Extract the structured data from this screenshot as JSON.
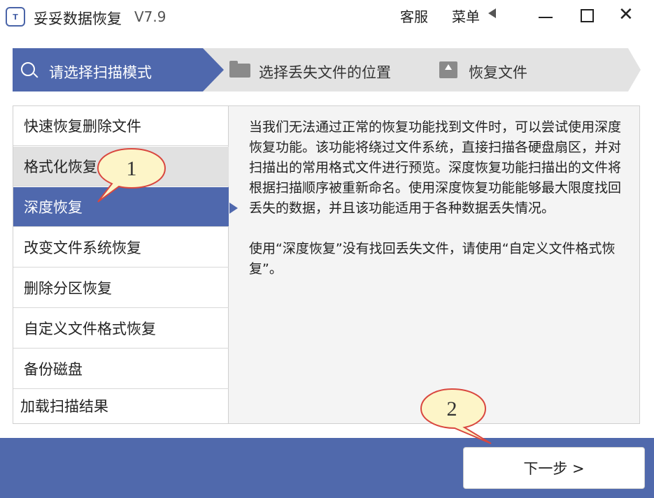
{
  "window": {
    "app_icon": "recovery-app-icon",
    "app_icon_text": "T",
    "title": "妥妥数据恢复",
    "version": "V7.9",
    "service": "客服",
    "menu": "菜单"
  },
  "steps": [
    {
      "label": "请选择扫描模式",
      "icon": "search-icon",
      "active": true
    },
    {
      "label": "选择丢失文件的位置",
      "icon": "folder-icon",
      "active": false
    },
    {
      "label": "恢复文件",
      "icon": "recover-icon",
      "active": false
    }
  ],
  "modes": [
    {
      "label": "快速恢复删除文件"
    },
    {
      "label": "格式化恢复"
    },
    {
      "label": "深度恢复",
      "selected": true
    },
    {
      "label": "改变文件系统恢复"
    },
    {
      "label": "删除分区恢复"
    },
    {
      "label": "自定义文件格式恢复"
    },
    {
      "label": "备份磁盘"
    },
    {
      "label": "加载扫描结果"
    }
  ],
  "description": {
    "para1": "当我们无法通过正常的恢复功能找到文件时，可以尝试使用深度恢复功能。该功能将绕过文件系统，直接扫描各硬盘扇区，并对扫描出的常用格式文件进行预览。深度恢复功能扫描出的文件将根据扫描顺序被重新命名。使用深度恢复功能能够最大限度找回丢失的数据，并且该功能适用于各种数据丢失情况。",
    "para2": "使用“深度恢复”没有找回丢失文件，请使用“自定义文件格式恢复”。"
  },
  "next_button": "下一步 >",
  "callouts": [
    {
      "number": "1"
    },
    {
      "number": "2"
    }
  ],
  "colors": {
    "accent": "#4f68ad",
    "bottom_bar": "#5069ac",
    "callout_fill": "#fdf5c8",
    "callout_border": "#d9473f"
  }
}
